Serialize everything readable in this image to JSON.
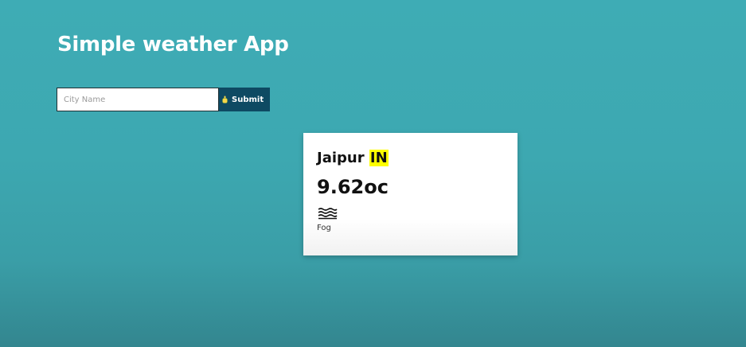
{
  "app": {
    "title": "Simple weather App"
  },
  "search": {
    "placeholder": "City Name",
    "value": "",
    "submit_label": "Submit"
  },
  "weather": {
    "city": "Jaipur",
    "country": "IN",
    "temperature": "9.62oc",
    "condition": "Fog",
    "condition_icon": "fog-icon"
  },
  "colors": {
    "background": "#3eacb5",
    "submit_button": "#0e4a63",
    "country_highlight": "#ffff00"
  }
}
